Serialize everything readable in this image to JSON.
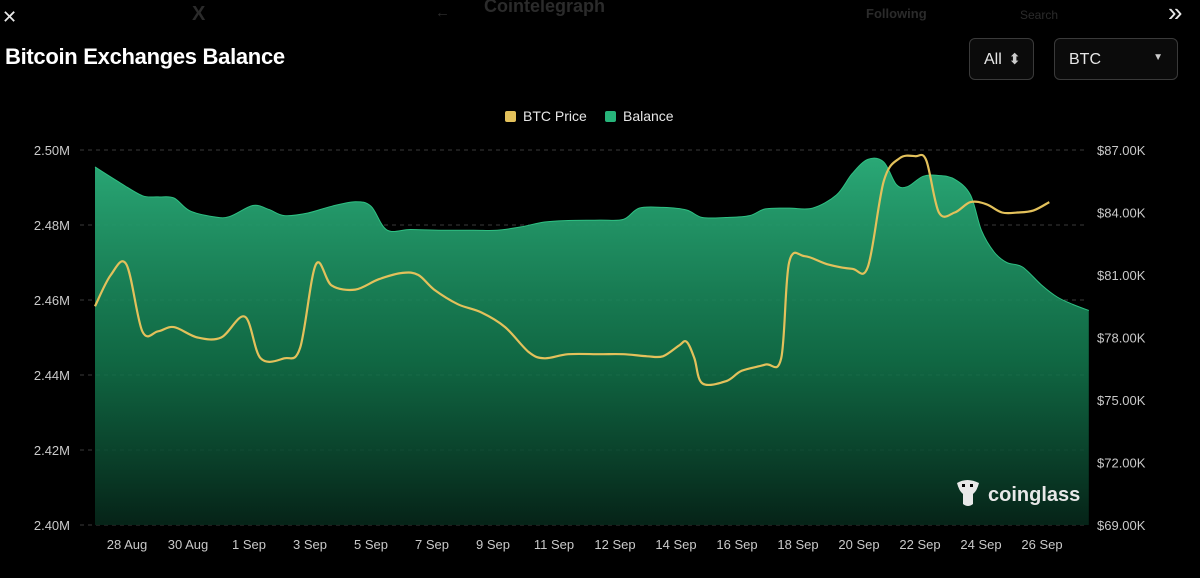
{
  "header": {
    "close_glyph": "✕",
    "expand_glyph": "»",
    "bg_logo": "X",
    "bg_back": "←",
    "bg_account": "Cointelegraph",
    "bg_following": "Following",
    "bg_search": "Search"
  },
  "controls": {
    "range_label": "All",
    "range_arrow": "⬍",
    "asset_label": "BTC",
    "asset_arrow": "▼"
  },
  "watermark": {
    "text": "coinglass"
  },
  "colors": {
    "price": "#e3c15b",
    "balance": "#27b47a",
    "background": "#000000"
  },
  "chart_data": {
    "type": "area",
    "title": "Bitcoin Exchanges Balance",
    "legend": {
      "position": "top-center",
      "entries": [
        "BTC Price",
        "Balance"
      ]
    },
    "grid": true,
    "x_tick_labels": [
      "28 Aug",
      "30 Aug",
      "1 Sep",
      "3 Sep",
      "5 Sep",
      "7 Sep",
      "9 Sep",
      "11 Sep",
      "12 Sep",
      "14 Sep",
      "16 Sep",
      "18 Sep",
      "20 Sep",
      "22 Sep",
      "24 Sep",
      "26 Sep"
    ],
    "left_axis": {
      "ticks": [
        "2.50M",
        "2.48M",
        "2.46M",
        "2.44M",
        "2.42M",
        "2.40M"
      ],
      "values": [
        2.5,
        2.48,
        2.46,
        2.44,
        2.42,
        2.4
      ],
      "range": [
        2.4,
        2.5
      ]
    },
    "right_axis": {
      "ticks": [
        "$87.00K",
        "$84.00K",
        "$81.00K",
        "$78.00K",
        "$75.00K",
        "$72.00K",
        "$69.00K"
      ],
      "values": [
        87,
        84,
        81,
        78,
        75,
        72,
        69
      ],
      "range": [
        69,
        87
      ]
    },
    "series": [
      {
        "name": "Balance",
        "axis": "left",
        "unit": "M BTC",
        "points": [
          [
            0,
            2.4955
          ],
          [
            1.5,
            2.4915
          ],
          [
            3,
            2.4878
          ],
          [
            4,
            2.4875
          ],
          [
            5,
            2.4872
          ],
          [
            6,
            2.4838
          ],
          [
            7.5,
            2.4822
          ],
          [
            8.5,
            2.4822
          ],
          [
            10,
            2.4852
          ],
          [
            11,
            2.4842
          ],
          [
            12,
            2.4825
          ],
          [
            13.5,
            2.4832
          ],
          [
            15,
            2.485
          ],
          [
            16.5,
            2.4862
          ],
          [
            17.5,
            2.485
          ],
          [
            18.5,
            2.4787
          ],
          [
            20,
            2.4788
          ],
          [
            22,
            2.4786
          ],
          [
            24,
            2.4786
          ],
          [
            25.5,
            2.4786
          ],
          [
            27,
            2.4795
          ],
          [
            28.5,
            2.4808
          ],
          [
            30,
            2.4812
          ],
          [
            32,
            2.4813
          ],
          [
            33.5,
            2.4815
          ],
          [
            34.5,
            2.4845
          ],
          [
            36,
            2.4847
          ],
          [
            37.5,
            2.484
          ],
          [
            38.5,
            2.482
          ],
          [
            40,
            2.482
          ],
          [
            41.5,
            2.4825
          ],
          [
            42.5,
            2.4843
          ],
          [
            44,
            2.4845
          ],
          [
            45.5,
            2.4845
          ],
          [
            47,
            2.488
          ],
          [
            48,
            2.4937
          ],
          [
            49,
            2.4975
          ],
          [
            50,
            2.4968
          ],
          [
            50.8,
            2.4908
          ],
          [
            51.5,
            2.4902
          ],
          [
            52.5,
            2.493
          ],
          [
            53.5,
            2.4932
          ],
          [
            54.5,
            2.4922
          ],
          [
            55.5,
            2.488
          ],
          [
            56.2,
            2.4785
          ],
          [
            57,
            2.4728
          ],
          [
            57.8,
            2.47
          ],
          [
            58.8,
            2.4688
          ],
          [
            60,
            2.464
          ],
          [
            61,
            2.4608
          ],
          [
            62,
            2.4588
          ],
          [
            63,
            2.4572
          ]
        ]
      },
      {
        "name": "BTC Price",
        "axis": "right",
        "unit": "$K",
        "points": [
          [
            0,
            79.5
          ],
          [
            1,
            81.0
          ],
          [
            2,
            81.5
          ],
          [
            3,
            78.3
          ],
          [
            4,
            78.3
          ],
          [
            5,
            78.5
          ],
          [
            6.5,
            78.0
          ],
          [
            8,
            78.0
          ],
          [
            9.5,
            79.0
          ],
          [
            10.5,
            77.0
          ],
          [
            12,
            77.0
          ],
          [
            13,
            77.5
          ],
          [
            14,
            81.5
          ],
          [
            15,
            80.5
          ],
          [
            16.5,
            80.3
          ],
          [
            18,
            80.8
          ],
          [
            19.5,
            81.1
          ],
          [
            20.5,
            81.0
          ],
          [
            21.5,
            80.3
          ],
          [
            23,
            79.6
          ],
          [
            24.5,
            79.2
          ],
          [
            26,
            78.5
          ],
          [
            27.5,
            77.3
          ],
          [
            28.5,
            77.0
          ],
          [
            30,
            77.2
          ],
          [
            32,
            77.2
          ],
          [
            33.5,
            77.2
          ],
          [
            35,
            77.1
          ],
          [
            36,
            77.1
          ],
          [
            37,
            77.6
          ],
          [
            37.5,
            77.8
          ],
          [
            38,
            77.0
          ],
          [
            38.5,
            75.8
          ],
          [
            40,
            75.9
          ],
          [
            41,
            76.4
          ],
          [
            42.5,
            76.7
          ],
          [
            43.5,
            77.0
          ],
          [
            44,
            81.6
          ],
          [
            45,
            81.9
          ],
          [
            46.5,
            81.5
          ],
          [
            48,
            81.3
          ],
          [
            49,
            81.4
          ],
          [
            50,
            85.5
          ],
          [
            51,
            86.6
          ],
          [
            52,
            86.7
          ],
          [
            52.7,
            86.5
          ],
          [
            53.5,
            84.0
          ],
          [
            54.5,
            84.0
          ],
          [
            55.5,
            84.5
          ],
          [
            56.5,
            84.4
          ],
          [
            57.5,
            84.0
          ],
          [
            58.5,
            84.0
          ],
          [
            59.5,
            84.1
          ],
          [
            60.5,
            84.5
          ]
        ]
      }
    ]
  }
}
